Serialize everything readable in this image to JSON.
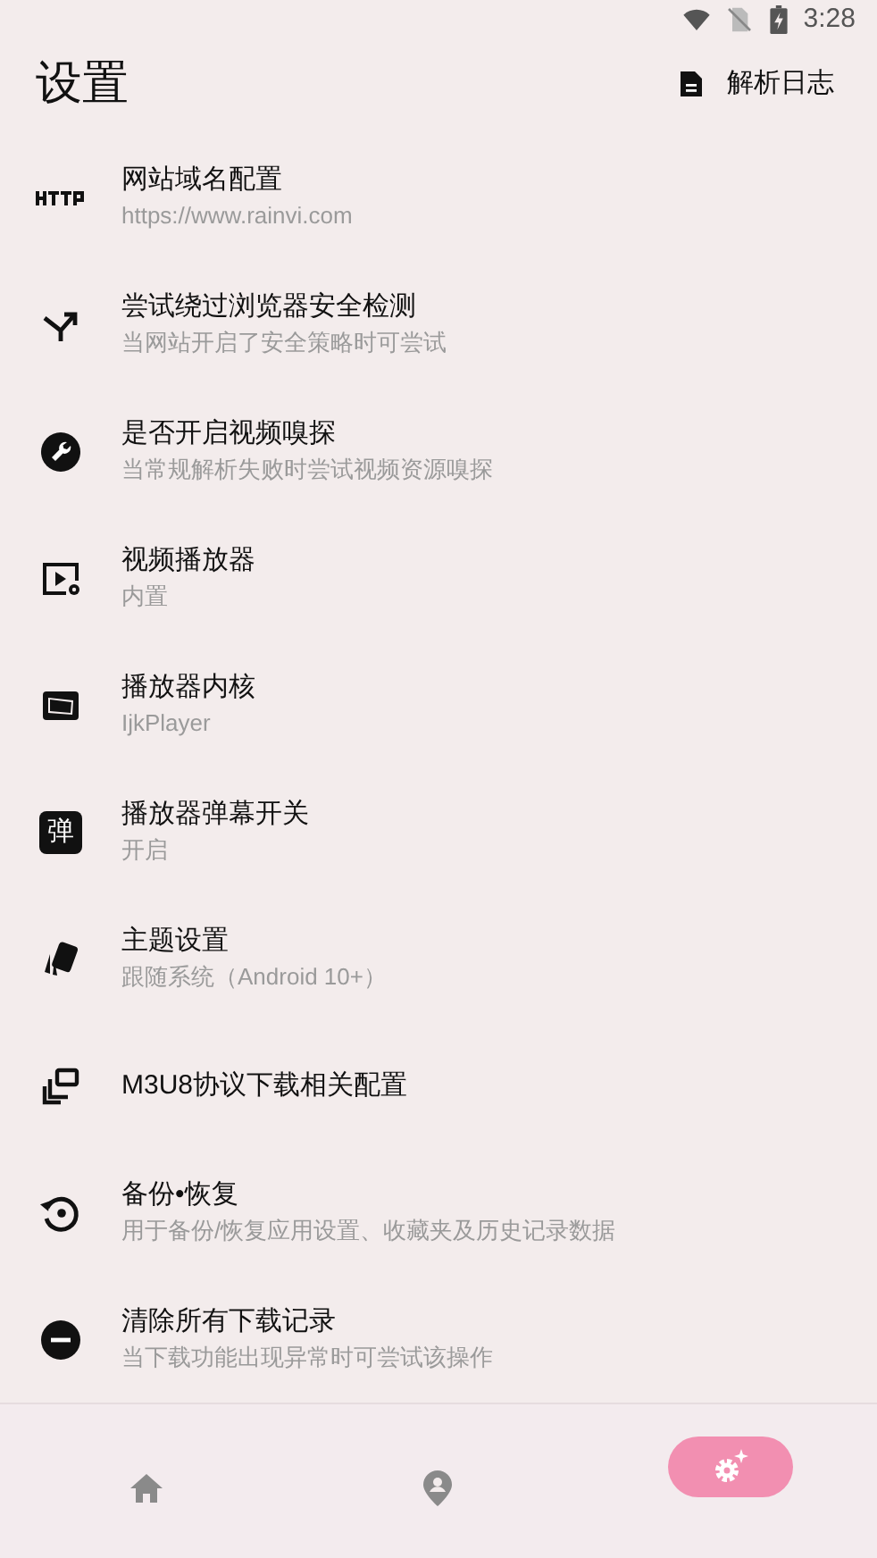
{
  "status_bar": {
    "time": "3:28"
  },
  "header": {
    "title": "设置",
    "action": "解析日志"
  },
  "settings": [
    {
      "title": "网站域名配置",
      "subtitle": "https://www.rainvi.com"
    },
    {
      "title": "尝试绕过浏览器安全检测",
      "subtitle": "当网站开启了安全策略时可尝试"
    },
    {
      "title": "是否开启视频嗅探",
      "subtitle": "当常规解析失败时尝试视频资源嗅探"
    },
    {
      "title": "视频播放器",
      "subtitle": "内置"
    },
    {
      "title": "播放器内核",
      "subtitle": "IjkPlayer"
    },
    {
      "title": "播放器弹幕开关",
      "subtitle": "开启",
      "badge": "弹"
    },
    {
      "title": "主题设置",
      "subtitle": "跟随系统（Android 10+）"
    },
    {
      "title": "M3U8协议下载相关配置"
    },
    {
      "title": "备份•恢复",
      "subtitle": "用于备份/恢复应用设置、收藏夹及历史记录数据"
    },
    {
      "title": "清除所有下载记录",
      "subtitle": "当下载功能出现异常时可尝试该操作"
    }
  ],
  "nav": [
    {
      "selected": false
    },
    {
      "selected": false
    },
    {
      "selected": true
    }
  ]
}
